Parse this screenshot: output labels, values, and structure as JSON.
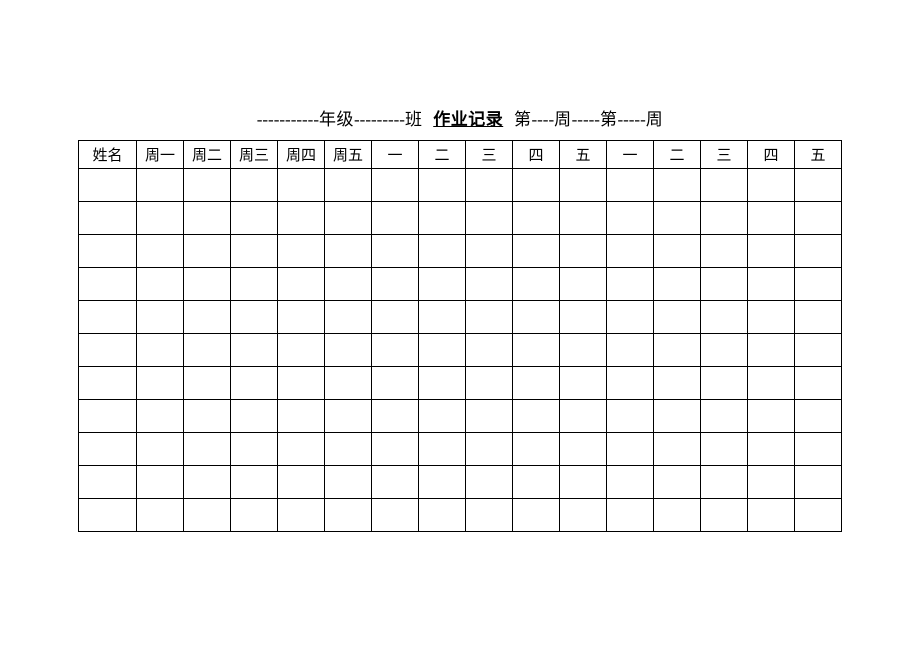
{
  "title": {
    "dash1": "-----------",
    "grade_label": "年级",
    "dash2": "---------",
    "class_label": "班",
    "main": "作业记录",
    "week_prefix1": "第",
    "dash3": "----",
    "week_suffix1": "周",
    "dash4": "-----",
    "week_prefix2": "第",
    "dash5": "-----",
    "week_suffix2": "周"
  },
  "headers": [
    "姓名",
    "周一",
    "周二",
    "周三",
    "周四",
    "周五",
    "一",
    "二",
    "三",
    "四",
    "五",
    "一",
    "二",
    "三",
    "四",
    "五"
  ],
  "row_count": 11
}
